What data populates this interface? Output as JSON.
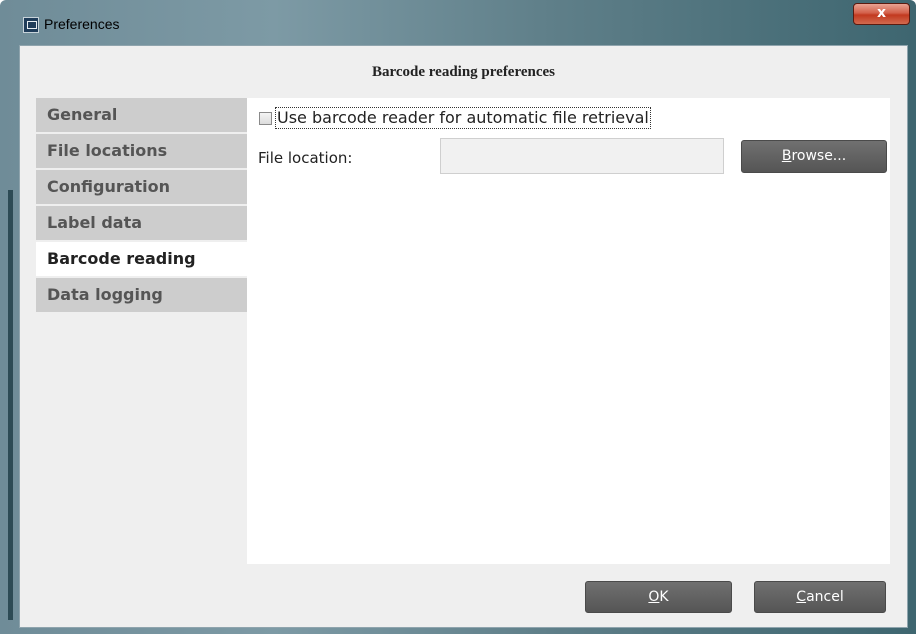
{
  "window": {
    "title": "Preferences",
    "close_label": "x",
    "app_icon": "preferences-app-icon",
    "close_icon": "close-icon"
  },
  "dialog": {
    "header": "Barcode reading preferences"
  },
  "nav": {
    "items": [
      {
        "label": "General",
        "active": false
      },
      {
        "label": "File locations",
        "active": false
      },
      {
        "label": "Configuration",
        "active": false
      },
      {
        "label": "Label data",
        "active": false
      },
      {
        "label": "Barcode reading",
        "active": true
      },
      {
        "label": "Data logging",
        "active": false
      }
    ]
  },
  "content": {
    "checkbox_label": "Use barcode reader for automatic file retrieval",
    "checkbox_checked": false,
    "file_location_label": "File location:",
    "file_location_value": "",
    "browse": {
      "mnemonic": "B",
      "rest": "rowse..."
    }
  },
  "buttons": {
    "ok": {
      "mnemonic": "O",
      "rest": "K"
    },
    "cancel": {
      "mnemonic": "C",
      "rest": "ancel"
    }
  }
}
